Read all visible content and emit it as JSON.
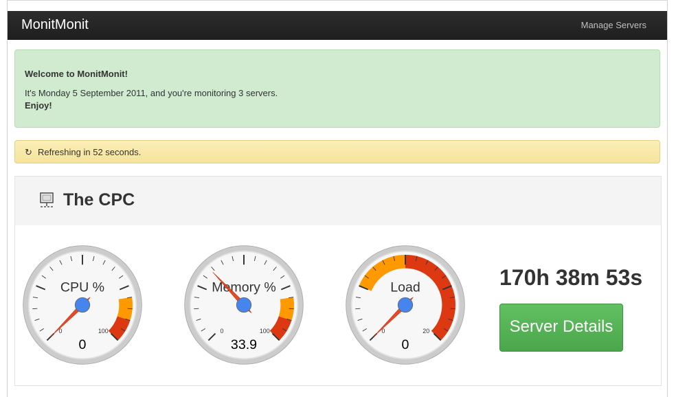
{
  "navbar": {
    "brand": "MonitMonit",
    "manage_servers": "Manage Servers"
  },
  "welcome": {
    "title": "Welcome to MonitMonit!",
    "message": "It's Monday 5 September 2011, and you're monitoring 3 servers.",
    "enjoy": "Enjoy!"
  },
  "refresh": {
    "icon": "refresh-icon",
    "text": "Refreshing in 52 seconds."
  },
  "server": {
    "icon": "server-icon",
    "name": "The CPC",
    "uptime": "170h 38m 53s",
    "details_button": "Server Details",
    "gauges": [
      {
        "label": "CPU %",
        "value": 0,
        "display": "0",
        "min": 0,
        "max": 100,
        "min_label": "0",
        "max_label": "100",
        "bands": [
          {
            "from": 80,
            "to": 90,
            "color": "#ff9900"
          },
          {
            "from": 90,
            "to": 100,
            "color": "#dc3912"
          }
        ]
      },
      {
        "label": "Memory %",
        "value": 33.9,
        "display": "33.9",
        "min": 0,
        "max": 100,
        "min_label": "0",
        "max_label": "100",
        "bands": [
          {
            "from": 80,
            "to": 90,
            "color": "#ff9900"
          },
          {
            "from": 90,
            "to": 100,
            "color": "#dc3912"
          }
        ]
      },
      {
        "label": "Load",
        "value": 0,
        "display": "0",
        "min": 0,
        "max": 20,
        "min_label": "0",
        "max_label": "20",
        "bands": [
          {
            "from": 5,
            "to": 10,
            "color": "#ff9900"
          },
          {
            "from": 10,
            "to": 20,
            "color": "#dc3912"
          }
        ]
      }
    ]
  },
  "colors": {
    "navbar": "#222222",
    "success_bg": "#d0ebd0",
    "warning_bg": "#fbefb7",
    "button_green": "#5bb75b",
    "needle": "#dc3912",
    "needle_pivot": "#4684ee"
  }
}
